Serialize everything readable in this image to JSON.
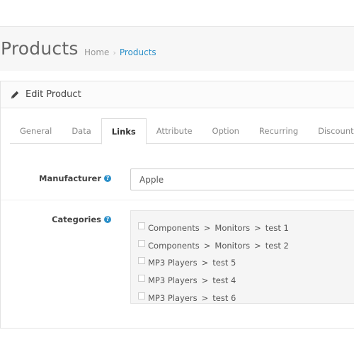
{
  "header": {
    "title": "Products",
    "breadcrumb": {
      "home": "Home",
      "separator": "›",
      "current": "Products"
    }
  },
  "panel": {
    "heading_icon": "pencil-icon",
    "heading": "Edit Product"
  },
  "tabs": [
    {
      "label": "General",
      "active": false
    },
    {
      "label": "Data",
      "active": false
    },
    {
      "label": "Links",
      "active": true
    },
    {
      "label": "Attribute",
      "active": false
    },
    {
      "label": "Option",
      "active": false
    },
    {
      "label": "Recurring",
      "active": false
    },
    {
      "label": "Discount",
      "active": false
    }
  ],
  "form": {
    "manufacturer": {
      "label": "Manufacturer",
      "value": "Apple"
    },
    "categories": {
      "label": "Categories",
      "items": [
        {
          "parts": [
            "Components",
            "Monitors",
            "test 1"
          ],
          "checked": false
        },
        {
          "parts": [
            "Components",
            "Monitors",
            "test 2"
          ],
          "checked": false
        },
        {
          "parts": [
            "MP3 Players",
            "test 5"
          ],
          "checked": false
        },
        {
          "parts": [
            "MP3 Players",
            "test 4"
          ],
          "checked": false
        },
        {
          "parts": [
            "MP3 Players",
            "test 6"
          ],
          "checked": false
        }
      ],
      "separator": ">"
    },
    "help_glyph": "?"
  },
  "colors": {
    "accent": "#2a8fc9",
    "header_bg": "#f7f7f7",
    "well_bg": "#f5f5f5"
  }
}
